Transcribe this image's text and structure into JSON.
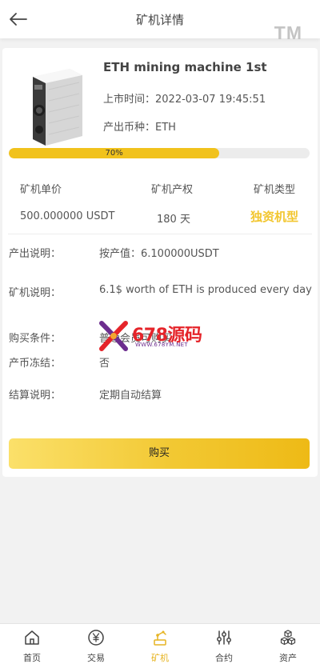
{
  "header": {
    "title": "矿机详情",
    "back_icon": "arrow-left-icon",
    "trademark": "TM"
  },
  "machine": {
    "image_icon": "asic-miner-image",
    "name": "ETH mining machine 1st",
    "launch_label": "上市时间：",
    "launch_time": "2022-03-07 19:45:51",
    "coin_label": "产出币种：",
    "coin": "ETH",
    "progress_percent": 70,
    "progress_text": "70%"
  },
  "stats": {
    "price_label": "矿机单价",
    "price_value": "500.000000 USDT",
    "term_label": "矿机产权",
    "term_value": "180 天",
    "type_label": "矿机类型",
    "type_value": "独资机型"
  },
  "details": [
    {
      "label": "产出说明：",
      "value": "按产值：6.100000USDT"
    },
    {
      "label": "矿机说明：",
      "value": "6.1$ worth of ETH is produced every day"
    },
    {
      "label": "购买条件：",
      "value": "普通会员可购买"
    },
    {
      "label": "产币冻结：",
      "value": "否"
    },
    {
      "label": "结算说明：",
      "value": "定期自动结算"
    }
  ],
  "buy_button": {
    "label": "购买"
  },
  "watermark": {
    "text": "678源码",
    "url": "WWW.678YM.NET"
  },
  "tabbar": {
    "items": [
      {
        "label": "首页",
        "icon": "home-icon",
        "active": false
      },
      {
        "label": "交易",
        "icon": "yen-circle-icon",
        "active": false
      },
      {
        "label": "矿机",
        "icon": "mining-robot-icon",
        "active": true
      },
      {
        "label": "合约",
        "icon": "sliders-icon",
        "active": false
      },
      {
        "label": "资产",
        "icon": "cubes-icon",
        "active": false
      }
    ]
  },
  "colors": {
    "accent": "#f1c21c",
    "type_highlight": "#f2c62f",
    "active_tab": "#e6b422",
    "watermark_red": "#e5242a",
    "watermark_purple": "#6c2d8e"
  }
}
